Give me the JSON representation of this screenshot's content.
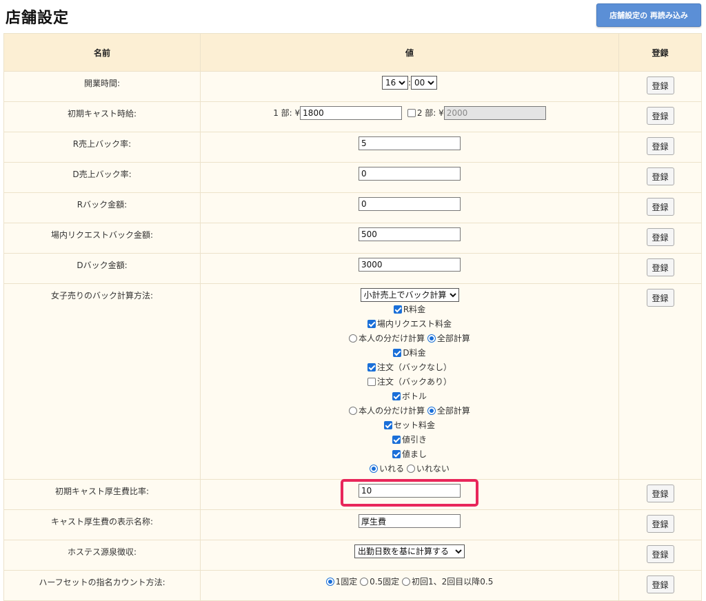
{
  "title": "店舗設定",
  "reload_button": "店舗設定の 再読み込み",
  "headers": {
    "name": "名前",
    "value": "値",
    "register": "登録"
  },
  "register_label": "登録",
  "rows": {
    "business_hours": {
      "label": "開業時間:",
      "hour": "16",
      "minute": "00"
    },
    "initial_wage": {
      "label": "初期キャスト時給:",
      "part1_label": "1 部: ¥",
      "part1_value": "1800",
      "part2_label": "2 部: ¥",
      "part2_value": "2000",
      "part2_checked": false
    },
    "r_sales_back_rate": {
      "label": "R売上バック率:",
      "value": "5"
    },
    "d_sales_back_rate": {
      "label": "D売上バック率:",
      "value": "0"
    },
    "r_back_amount": {
      "label": "Rバック金額:",
      "value": "0"
    },
    "house_request_back_amount": {
      "label": "場内リクエストバック金額:",
      "value": "500"
    },
    "d_back_amount": {
      "label": "Dバック金額:",
      "value": "3000"
    },
    "girl_sales_back_method": {
      "label": "女子売りのバック計算方法:",
      "select_value": "小計売上でバック計算",
      "r_fee": {
        "label": "R料金",
        "checked": true
      },
      "house_request_fee": {
        "label": "場内リクエスト料金",
        "checked": true
      },
      "radio_a": {
        "self_only": "本人の分だけ計算",
        "all": "全部計算",
        "selected": "all"
      },
      "d_fee": {
        "label": "D料金",
        "checked": true
      },
      "order_no_back": {
        "label": "注文（バックなし）",
        "checked": true
      },
      "order_with_back": {
        "label": "注文（バックあり）",
        "checked": false
      },
      "bottle": {
        "label": "ボトル",
        "checked": true
      },
      "radio_b": {
        "self_only": "本人の分だけ計算",
        "all": "全部計算",
        "selected": "all"
      },
      "set_fee": {
        "label": "セット料金",
        "checked": true
      },
      "discount": {
        "label": "値引き",
        "checked": true
      },
      "surcharge": {
        "label": "値まし",
        "checked": true
      },
      "radio_c": {
        "include": "いれる",
        "exclude": "いれない",
        "selected": "include"
      }
    },
    "welfare_ratio": {
      "label": "初期キャスト厚生費比率:",
      "value": "10"
    },
    "welfare_display_name": {
      "label": "キャスト厚生費の表示名称:",
      "value": "厚生費"
    },
    "hostess_withholding": {
      "label": "ホステス源泉徴収:",
      "select_value": "出勤日数を基に計算する"
    },
    "half_set_nomination": {
      "label": "ハーフセットの指名カウント方法:",
      "opt1": "1固定",
      "opt2": "0.5固定",
      "opt3": "初回1、2回目以降0.5",
      "selected": "opt1"
    }
  },
  "colors": {
    "header_bg": "#fcefd4",
    "row_bg": "#fffbf1",
    "accent": "#5b8fd6",
    "highlight": "#e8265a"
  }
}
